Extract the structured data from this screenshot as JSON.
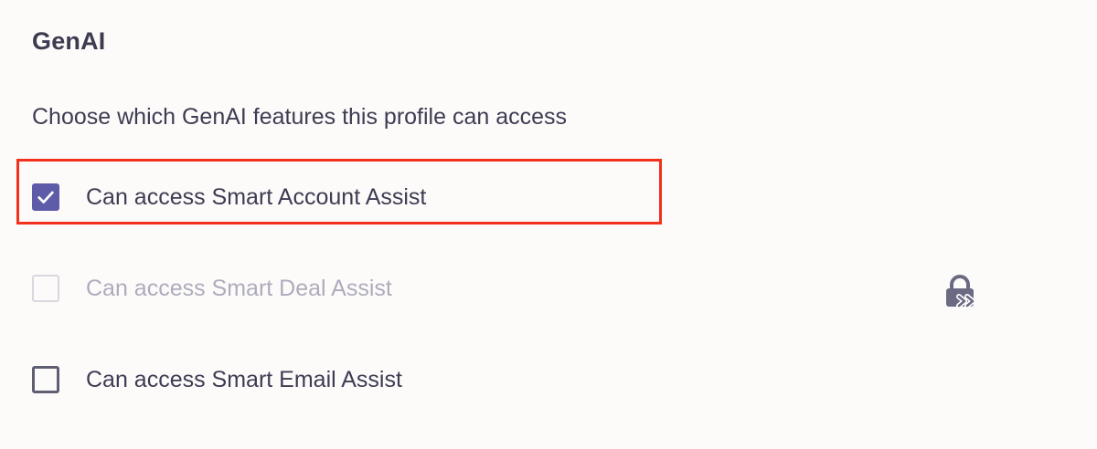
{
  "section": {
    "title": "GenAI",
    "description": "Choose which GenAI features this profile can access"
  },
  "options": [
    {
      "label": "Can access Smart Account Assist",
      "checked": true,
      "disabled": false
    },
    {
      "label": "Can access Smart Deal Assist",
      "checked": false,
      "disabled": true
    },
    {
      "label": "Can access Smart Email Assist",
      "checked": false,
      "disabled": false
    }
  ],
  "icons": {
    "check": "check-icon",
    "lock": "lock-upgrade-icon"
  },
  "colors": {
    "accent": "#5e5ba8",
    "text": "#3e3c52",
    "disabled_text": "#aeacbc",
    "highlight": "#f2301c",
    "background": "#fdfbfa"
  }
}
